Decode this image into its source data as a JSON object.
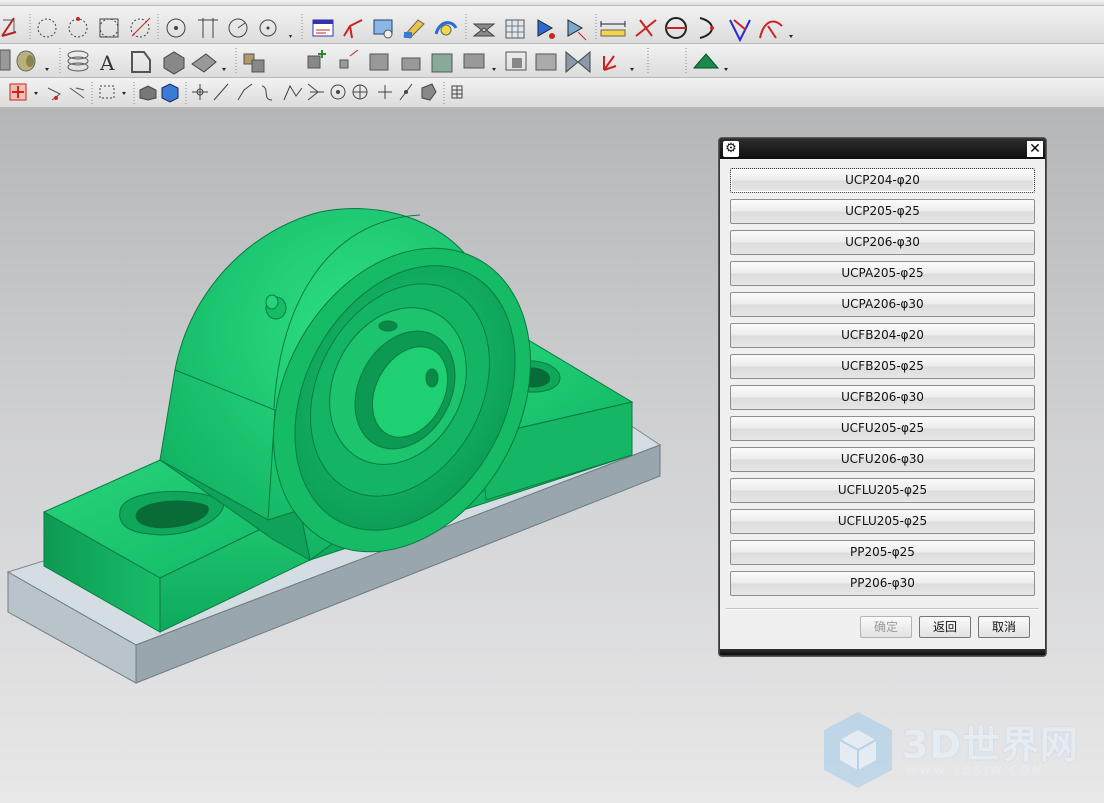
{
  "toolbar": {
    "row1": [
      "sketch-plane-icon",
      "circle-icon",
      "circle-3pt-icon",
      "circle-center-icon",
      "circle-tangent-icon",
      "point-icon",
      "trim-icon",
      "circle-point-icon",
      "circle-dropdown-icon",
      "feature-table-icon",
      "axis-icon",
      "datum-plane-icon",
      "edit-feature-icon",
      "replace-icon",
      "sew-icon",
      "mesh-icon",
      "analysis-icon",
      "analysis2-icon",
      "measure-distance-icon",
      "measure-angle-icon",
      "ellipse-icon",
      "arc-icon",
      "triangle-icon",
      "sketch-arc-icon"
    ],
    "row2": [
      "surface-icon",
      "cylinder-icon",
      "coil-icon",
      "text-icon",
      "shell-icon",
      "block-icon",
      "sheet-icon",
      "assembly-icon",
      "add-component-icon",
      "pattern-icon",
      "mate-icon",
      "move-component-icon",
      "explode-icon",
      "reposition-icon",
      "wave-link-icon",
      "constraint-icon",
      "analysis-icon",
      "mirror-icon",
      "coordinate-icon",
      "render-icon"
    ],
    "row3": [
      "select-filter-icon",
      "select-option-icon",
      "snap-icon",
      "rectangle-select-icon",
      "shaded-icon",
      "solid-icon",
      "move-icon",
      "line-icon",
      "polyline-icon",
      "spline-icon",
      "curve-icon",
      "intersect-icon",
      "circle-snap-icon",
      "circle-center-snap-icon",
      "plus-icon",
      "slash-icon",
      "face-icon",
      "grid-icon"
    ]
  },
  "dialog": {
    "options": [
      "UCP204-φ20",
      "UCP205-φ25",
      "UCP206-φ30",
      "UCPA205-φ25",
      "UCPA206-φ30",
      "UCFB204-φ20",
      "UCFB205-φ25",
      "UCFB206-φ30",
      "UCFU205-φ25",
      "UCFU206-φ30",
      "UCFLU205-φ25",
      "UCFLU205-φ25",
      "PP205-φ25",
      "PP206-φ30"
    ],
    "ok_label": "确定",
    "back_label": "返回",
    "cancel_label": "取消"
  },
  "watermark": {
    "title": "3D世界网",
    "url": "WWW.3DSJW.COM"
  },
  "colors": {
    "model_green": "#14c56c",
    "base_plate": "#c3cdd3",
    "dialog_title": "#111111"
  }
}
